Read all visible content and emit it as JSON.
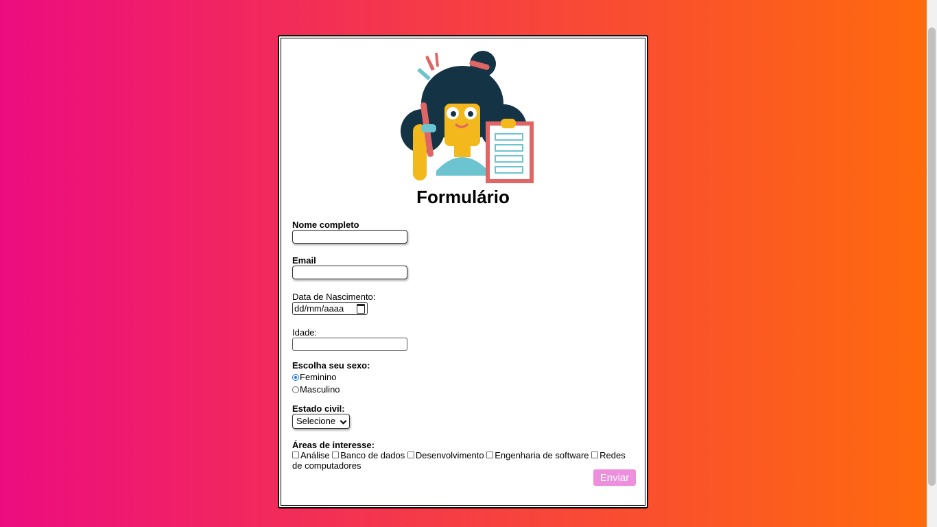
{
  "form": {
    "title": "Formulário",
    "labels": {
      "nome": "Nome completo",
      "email": "Email",
      "data_nascimento": "Data de Nascimento:",
      "idade": "Idade:",
      "sexo": "Escolha seu sexo:",
      "estado_civil": "Estado civil:",
      "areas": "Áreas de interesse:"
    },
    "date_placeholder": "dd/mm/aaaa",
    "sexo_options": [
      {
        "label": "Feminino",
        "checked": true
      },
      {
        "label": "Masculino",
        "checked": false
      }
    ],
    "estado_civil_selected": "Selecione",
    "areas_options": [
      "Análise",
      "Banco de dados",
      "Desenvolvimento",
      "Engenharia de software",
      "Redes de computadores"
    ],
    "submit_label": "Enviar"
  },
  "colors": {
    "gradient_start": "#ec0c7f",
    "gradient_end": "#ff6b0c",
    "button": "#ee8fde",
    "radio_checked": "#1a73e8"
  },
  "icons": {
    "illustration": "woman-with-clipboard-illustration",
    "calendar": "calendar-icon",
    "select_arrow": "chevron-down-icon"
  }
}
